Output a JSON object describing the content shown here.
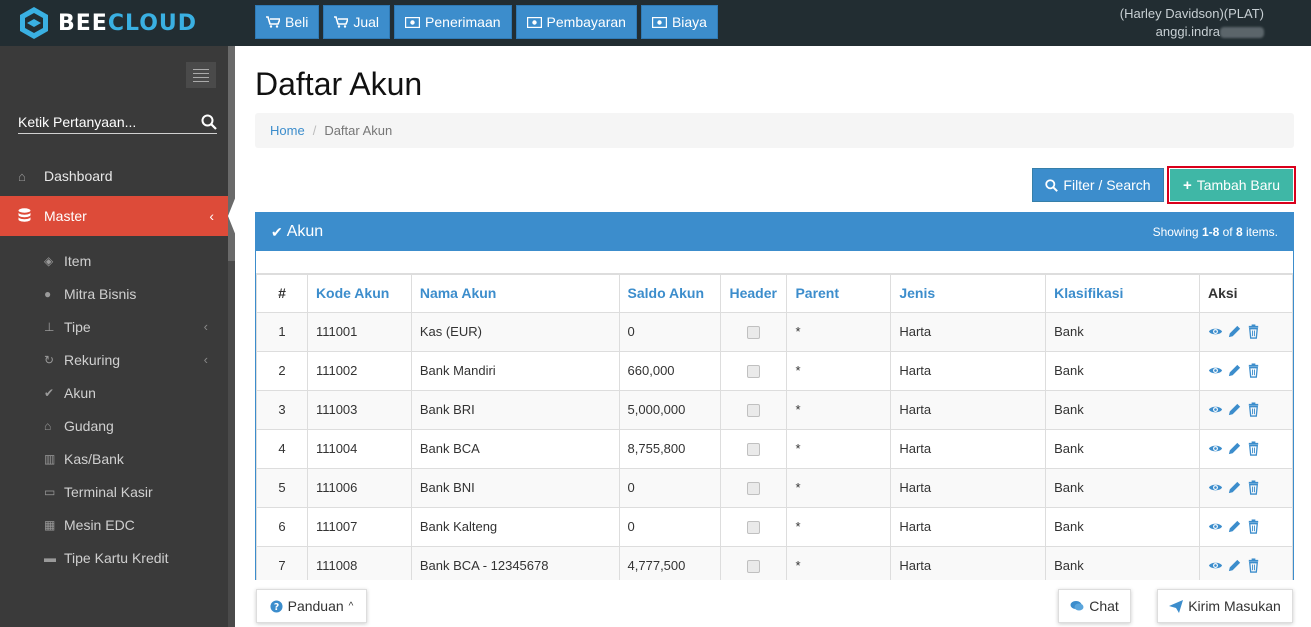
{
  "brand": {
    "part1": "BEE",
    "part2": "CLOUD",
    "accent": "#3ab0e2"
  },
  "topnav": [
    {
      "label": "Beli",
      "icon": "cart-icon"
    },
    {
      "label": "Jual",
      "icon": "cart-icon"
    },
    {
      "label": "Penerimaan",
      "icon": "money-icon"
    },
    {
      "label": "Pembayaran",
      "icon": "money-icon"
    },
    {
      "label": "Biaya",
      "icon": "money-icon"
    }
  ],
  "user": {
    "company": "(Harley Davidson)(PLAT)",
    "name": "anggi.indra"
  },
  "sidebar": {
    "search_placeholder": "Ketik Pertanyaan...",
    "menu": [
      {
        "label": "Dashboard",
        "icon": "home-icon"
      },
      {
        "label": "Master",
        "icon": "database-icon",
        "active": true
      }
    ],
    "submenu": [
      {
        "label": "Item",
        "icon": "cube-icon"
      },
      {
        "label": "Mitra Bisnis",
        "icon": "users-icon"
      },
      {
        "label": "Tipe",
        "icon": "sitemap-icon",
        "has_children": true
      },
      {
        "label": "Rekuring",
        "icon": "refresh-icon",
        "has_children": true
      },
      {
        "label": "Akun",
        "icon": "check-icon"
      },
      {
        "label": "Gudang",
        "icon": "home-icon"
      },
      {
        "label": "Kas/Bank",
        "icon": "bank-icon"
      },
      {
        "label": "Terminal Kasir",
        "icon": "desktop-icon"
      },
      {
        "label": "Mesin EDC",
        "icon": "calculator-icon"
      },
      {
        "label": "Tipe Kartu Kredit",
        "icon": "credit-card-icon"
      }
    ]
  },
  "page": {
    "title": "Daftar Akun",
    "breadcrumb": {
      "home": "Home",
      "current": "Daftar Akun"
    },
    "filter_label": "Filter / Search",
    "add_label": "Tambah Baru"
  },
  "panel": {
    "title": "Akun",
    "summary": {
      "prefix": "Showing ",
      "range": "1-8",
      "mid": " of ",
      "total": "8",
      "suffix": " items."
    }
  },
  "table": {
    "columns": [
      "#",
      "Kode Akun",
      "Nama Akun",
      "Saldo Akun",
      "Header",
      "Parent",
      "Jenis",
      "Klasifikasi",
      "Aksi"
    ],
    "rows": [
      {
        "no": "1",
        "kode": "111001",
        "nama": "Kas (EUR)",
        "saldo": "0",
        "parent": "*",
        "jenis": "Harta",
        "klasifikasi": "Bank"
      },
      {
        "no": "2",
        "kode": "111002",
        "nama": "Bank Mandiri",
        "saldo": "660,000",
        "parent": "*",
        "jenis": "Harta",
        "klasifikasi": "Bank"
      },
      {
        "no": "3",
        "kode": "111003",
        "nama": "Bank BRI",
        "saldo": "5,000,000",
        "parent": "*",
        "jenis": "Harta",
        "klasifikasi": "Bank"
      },
      {
        "no": "4",
        "kode": "111004",
        "nama": "Bank BCA",
        "saldo": "8,755,800",
        "parent": "*",
        "jenis": "Harta",
        "klasifikasi": "Bank"
      },
      {
        "no": "5",
        "kode": "111006",
        "nama": "Bank BNI",
        "saldo": "0",
        "parent": "*",
        "jenis": "Harta",
        "klasifikasi": "Bank"
      },
      {
        "no": "6",
        "kode": "111007",
        "nama": "Bank Kalteng",
        "saldo": "0",
        "parent": "*",
        "jenis": "Harta",
        "klasifikasi": "Bank"
      },
      {
        "no": "7",
        "kode": "111008",
        "nama": "Bank BCA - 12345678",
        "saldo": "4,777,500",
        "parent": "*",
        "jenis": "Harta",
        "klasifikasi": "Bank"
      }
    ]
  },
  "bottom": {
    "guide": "Panduan",
    "chat": "Chat",
    "feedback": "Kirim Masukan"
  }
}
